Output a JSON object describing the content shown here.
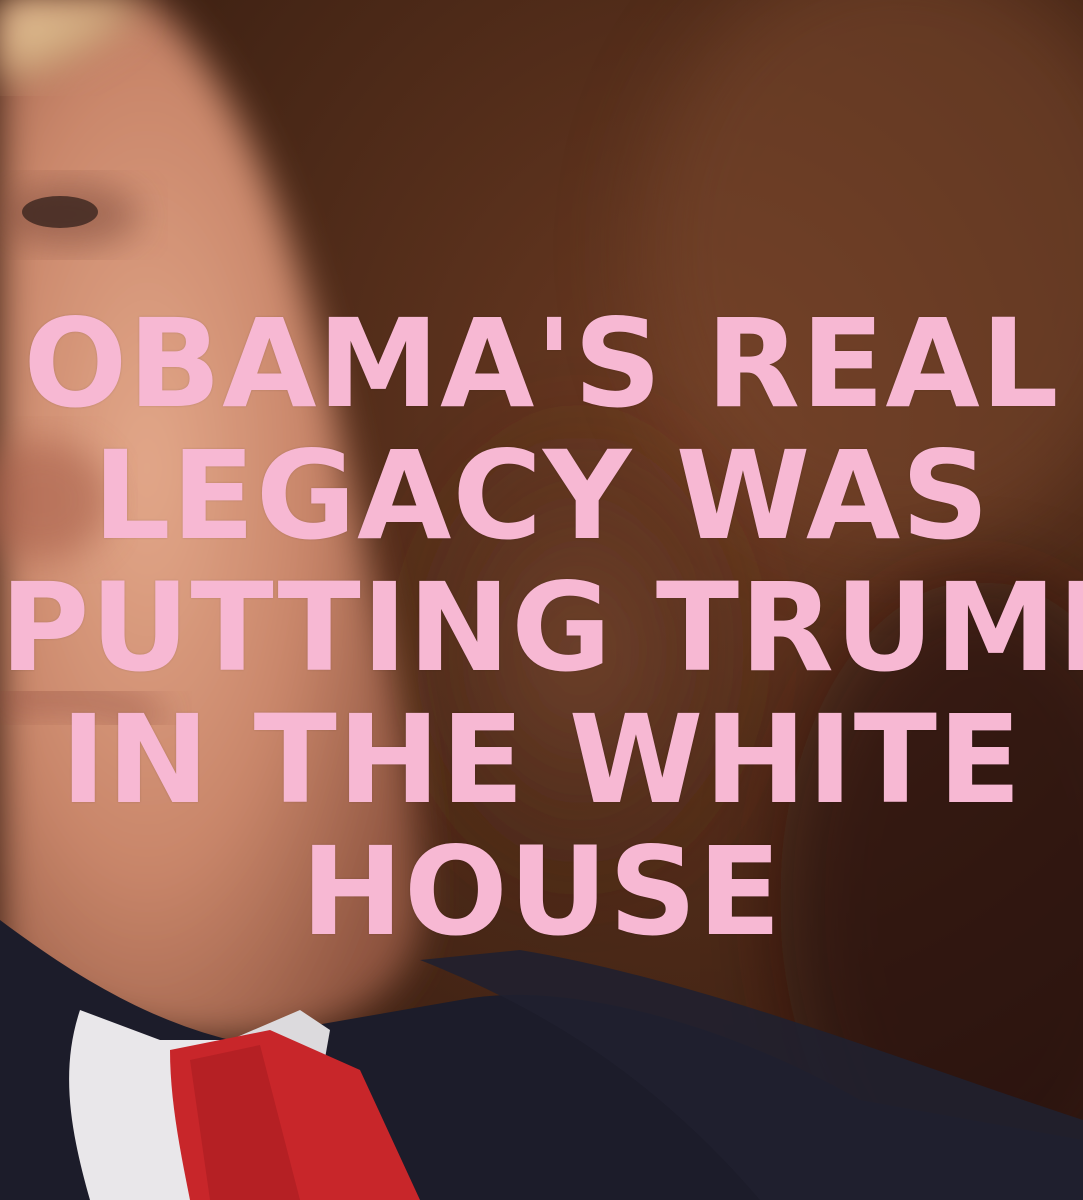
{
  "caption": {
    "lines": [
      "OBAMA'S REAL",
      "LEGACY WAS",
      "PUTTING TRUMP",
      "IN THE WHITE",
      "HOUSE"
    ],
    "color": "#f7b8d3"
  },
  "photo": {
    "subject": "close-up portrait of a man in a dark suit, white shirt and red tie, with a blurred brown background"
  }
}
